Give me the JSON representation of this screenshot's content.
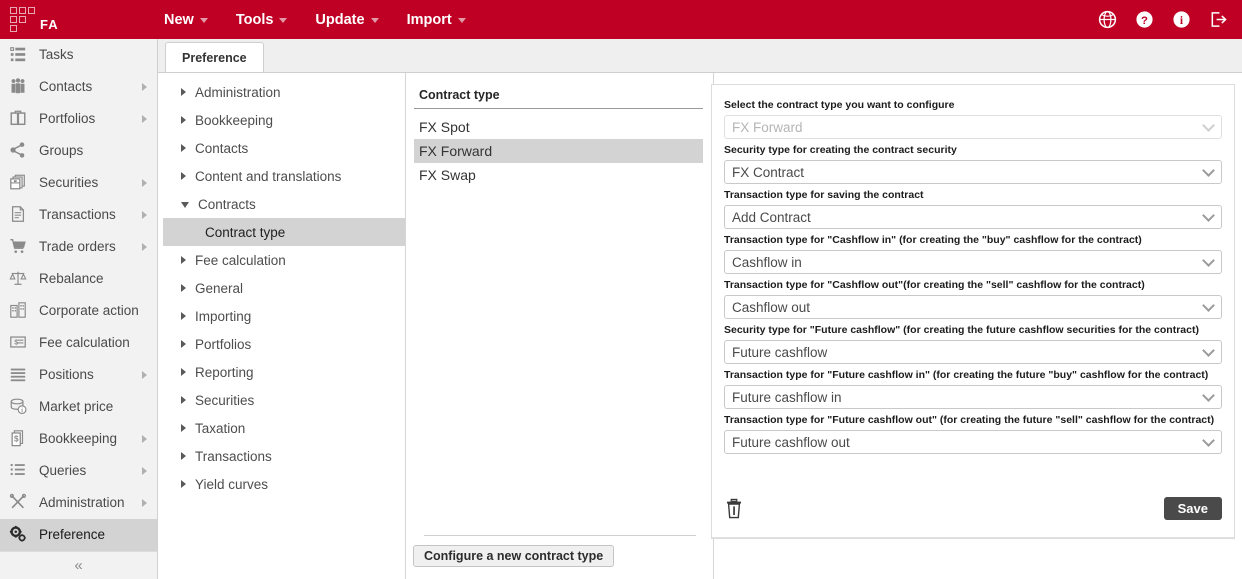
{
  "topbar": {
    "logo_text": "FA",
    "logo_icon": "grid-squares-logo",
    "nav": [
      {
        "label": "New",
        "icon": "chevron-down-icon"
      },
      {
        "label": "Tools",
        "icon": "chevron-down-icon"
      },
      {
        "label": "Update",
        "icon": "chevron-down-icon"
      },
      {
        "label": "Import",
        "icon": "chevron-down-icon"
      }
    ],
    "actions": [
      {
        "icon": "globe-icon",
        "name": "language-globe-icon"
      },
      {
        "icon": "help-icon",
        "name": "help-icon"
      },
      {
        "icon": "info-icon",
        "name": "info-icon"
      },
      {
        "icon": "logout-icon",
        "name": "logout-icon"
      }
    ],
    "accent_color": "#bf0024"
  },
  "sidebar": {
    "items": [
      {
        "label": "Tasks",
        "icon": "tasks-icon",
        "has_arrow": false,
        "active": false
      },
      {
        "label": "Contacts",
        "icon": "contacts-icon",
        "has_arrow": true,
        "active": false
      },
      {
        "label": "Portfolios",
        "icon": "portfolios-icon",
        "has_arrow": true,
        "active": false
      },
      {
        "label": "Groups",
        "icon": "groups-icon",
        "has_arrow": false,
        "active": false
      },
      {
        "label": "Securities",
        "icon": "securities-icon",
        "has_arrow": true,
        "active": false
      },
      {
        "label": "Transactions",
        "icon": "transactions-icon",
        "has_arrow": true,
        "active": false
      },
      {
        "label": "Trade orders",
        "icon": "trade-orders-icon",
        "has_arrow": true,
        "active": false
      },
      {
        "label": "Rebalance",
        "icon": "rebalance-icon",
        "has_arrow": false,
        "active": false
      },
      {
        "label": "Corporate action",
        "icon": "corporate-action-icon",
        "has_arrow": false,
        "active": false
      },
      {
        "label": "Fee calculation",
        "icon": "fee-calculation-icon",
        "has_arrow": false,
        "active": false
      },
      {
        "label": "Positions",
        "icon": "positions-icon",
        "has_arrow": true,
        "active": false
      },
      {
        "label": "Market price",
        "icon": "market-price-icon",
        "has_arrow": false,
        "active": false
      },
      {
        "label": "Bookkeeping",
        "icon": "bookkeeping-icon",
        "has_arrow": true,
        "active": false
      },
      {
        "label": "Queries",
        "icon": "queries-icon",
        "has_arrow": true,
        "active": false
      },
      {
        "label": "Administration",
        "icon": "administration-icon",
        "has_arrow": true,
        "active": false
      },
      {
        "label": "Preference",
        "icon": "preference-gears-icon",
        "has_arrow": false,
        "active": true
      }
    ],
    "collapse_icon": "double-chevron-left-icon"
  },
  "tabs": [
    {
      "label": "Preference",
      "active": true
    }
  ],
  "tree": [
    {
      "label": "Administration",
      "state": "collapsed",
      "level": 0,
      "selected": false
    },
    {
      "label": "Bookkeeping",
      "state": "collapsed",
      "level": 0,
      "selected": false
    },
    {
      "label": "Contacts",
      "state": "collapsed",
      "level": 0,
      "selected": false
    },
    {
      "label": "Content and translations",
      "state": "collapsed",
      "level": 0,
      "selected": false
    },
    {
      "label": "Contracts",
      "state": "expanded",
      "level": 0,
      "selected": false
    },
    {
      "label": "Contract type",
      "state": "leaf",
      "level": 1,
      "selected": true
    },
    {
      "label": "Fee calculation",
      "state": "collapsed",
      "level": 0,
      "selected": false
    },
    {
      "label": "General",
      "state": "collapsed",
      "level": 0,
      "selected": false
    },
    {
      "label": "Importing",
      "state": "collapsed",
      "level": 0,
      "selected": false
    },
    {
      "label": "Portfolios",
      "state": "collapsed",
      "level": 0,
      "selected": false
    },
    {
      "label": "Reporting",
      "state": "collapsed",
      "level": 0,
      "selected": false
    },
    {
      "label": "Securities",
      "state": "collapsed",
      "level": 0,
      "selected": false
    },
    {
      "label": "Taxation",
      "state": "collapsed",
      "level": 0,
      "selected": false
    },
    {
      "label": "Transactions",
      "state": "collapsed",
      "level": 0,
      "selected": false
    },
    {
      "label": "Yield curves",
      "state": "collapsed",
      "level": 0,
      "selected": false
    }
  ],
  "contract_list": {
    "header": "Contract type",
    "rows": [
      {
        "label": "FX Spot",
        "selected": false
      },
      {
        "label": "FX Forward",
        "selected": true
      },
      {
        "label": "FX Swap",
        "selected": false
      }
    ],
    "new_button": "Configure a new contract type"
  },
  "form": {
    "fields": [
      {
        "label": "Select the contract type you want to configure",
        "value": "FX Forward",
        "disabled": true
      },
      {
        "label": "Security type for creating the contract security",
        "value": "FX Contract",
        "disabled": false
      },
      {
        "label": "Transaction type for saving the contract",
        "value": "Add Contract",
        "disabled": false
      },
      {
        "label": "Transaction type for \"Cashflow in\" (for creating the \"buy\" cashflow for the contract)",
        "value": "Cashflow in",
        "disabled": false
      },
      {
        "label": "Transaction type for \"Cashflow out\"(for creating the \"sell\" cashflow for the contract)",
        "value": "Cashflow out",
        "disabled": false
      },
      {
        "label": "Security type for \"Future cashflow\" (for creating the future cashflow securities for the contract)",
        "value": "Future cashflow",
        "disabled": false
      },
      {
        "label": "Transaction type for \"Future cashflow in\" (for creating the future \"buy\" cashflow for the contract)",
        "value": "Future cashflow in",
        "disabled": false
      },
      {
        "label": "Transaction type for \"Future cashflow out\" (for creating the future \"sell\" cashflow for the contract)",
        "value": "Future cashflow out",
        "disabled": false
      }
    ],
    "delete_icon": "trash-icon",
    "save_label": "Save"
  }
}
